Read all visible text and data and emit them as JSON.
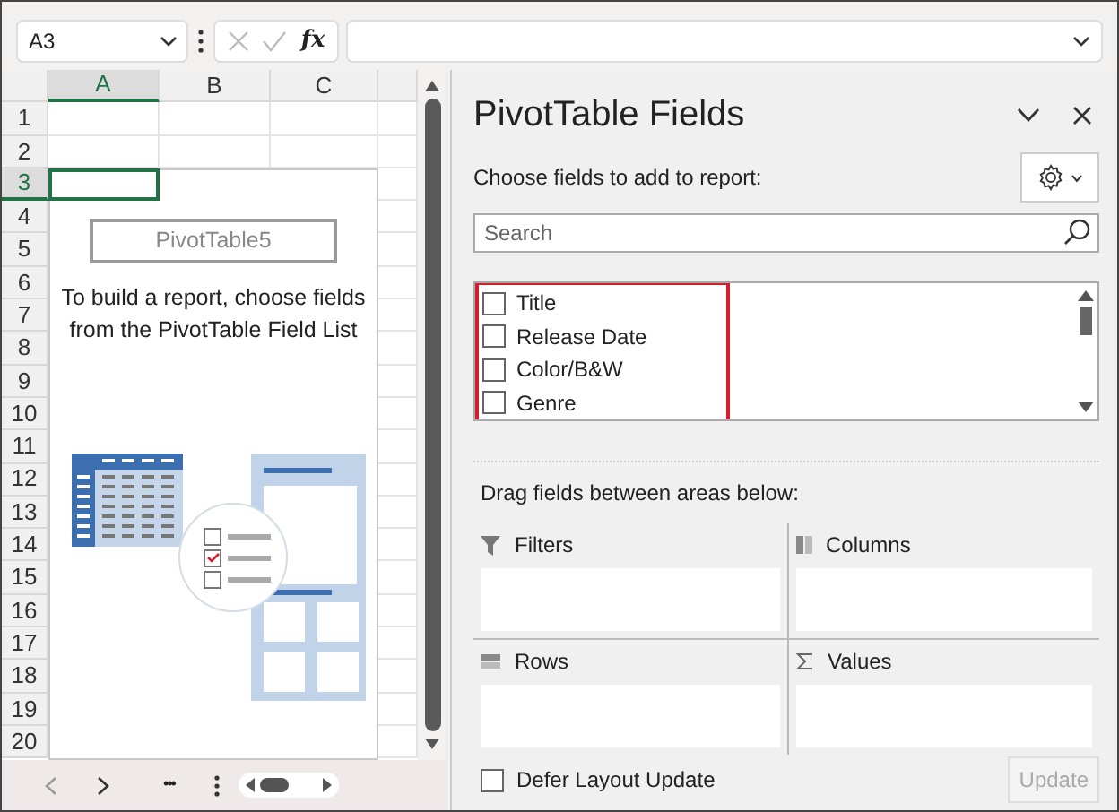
{
  "name_box": {
    "value": "A3"
  },
  "formula_bar": {
    "function_label": "fx"
  },
  "sheet": {
    "columns": [
      {
        "label": "A",
        "selected": true
      },
      {
        "label": "B",
        "selected": false
      },
      {
        "label": "C",
        "selected": false
      }
    ],
    "rows": [
      {
        "label": "1",
        "selected": false
      },
      {
        "label": "2",
        "selected": false
      },
      {
        "label": "3",
        "selected": true
      },
      {
        "label": "4",
        "selected": false
      },
      {
        "label": "5",
        "selected": false
      },
      {
        "label": "6",
        "selected": false
      },
      {
        "label": "7",
        "selected": false
      },
      {
        "label": "8",
        "selected": false
      },
      {
        "label": "9",
        "selected": false
      },
      {
        "label": "10",
        "selected": false
      },
      {
        "label": "11",
        "selected": false
      },
      {
        "label": "12",
        "selected": false
      },
      {
        "label": "13",
        "selected": false
      },
      {
        "label": "14",
        "selected": false
      },
      {
        "label": "15",
        "selected": false
      },
      {
        "label": "16",
        "selected": false
      },
      {
        "label": "17",
        "selected": false
      },
      {
        "label": "18",
        "selected": false
      },
      {
        "label": "19",
        "selected": false
      },
      {
        "label": "20",
        "selected": false
      }
    ]
  },
  "pivot_placeholder": {
    "name": "PivotTable5",
    "message": "To build a report, choose fields from the PivotTable Field List"
  },
  "sheet_nav": {
    "more": "•••"
  },
  "field_pane": {
    "title": "PivotTable Fields",
    "subtitle": "Choose fields to add to report:",
    "search": {
      "placeholder": "Search"
    },
    "fields_highlighted": true,
    "fields": [
      {
        "label": "Title",
        "checked": false
      },
      {
        "label": "Release Date",
        "checked": false
      },
      {
        "label": "Color/B&W",
        "checked": false
      },
      {
        "label": "Genre",
        "checked": false
      }
    ],
    "areas_label": "Drag fields between areas below:",
    "areas": [
      {
        "label": "Filters",
        "kind": "filters"
      },
      {
        "label": "Columns",
        "kind": "columns"
      },
      {
        "label": "Rows",
        "kind": "rows"
      },
      {
        "label": "Values",
        "kind": "values"
      }
    ],
    "defer": {
      "label": "Defer Layout Update",
      "checked": false
    },
    "update": {
      "label": "Update",
      "disabled": true
    }
  }
}
